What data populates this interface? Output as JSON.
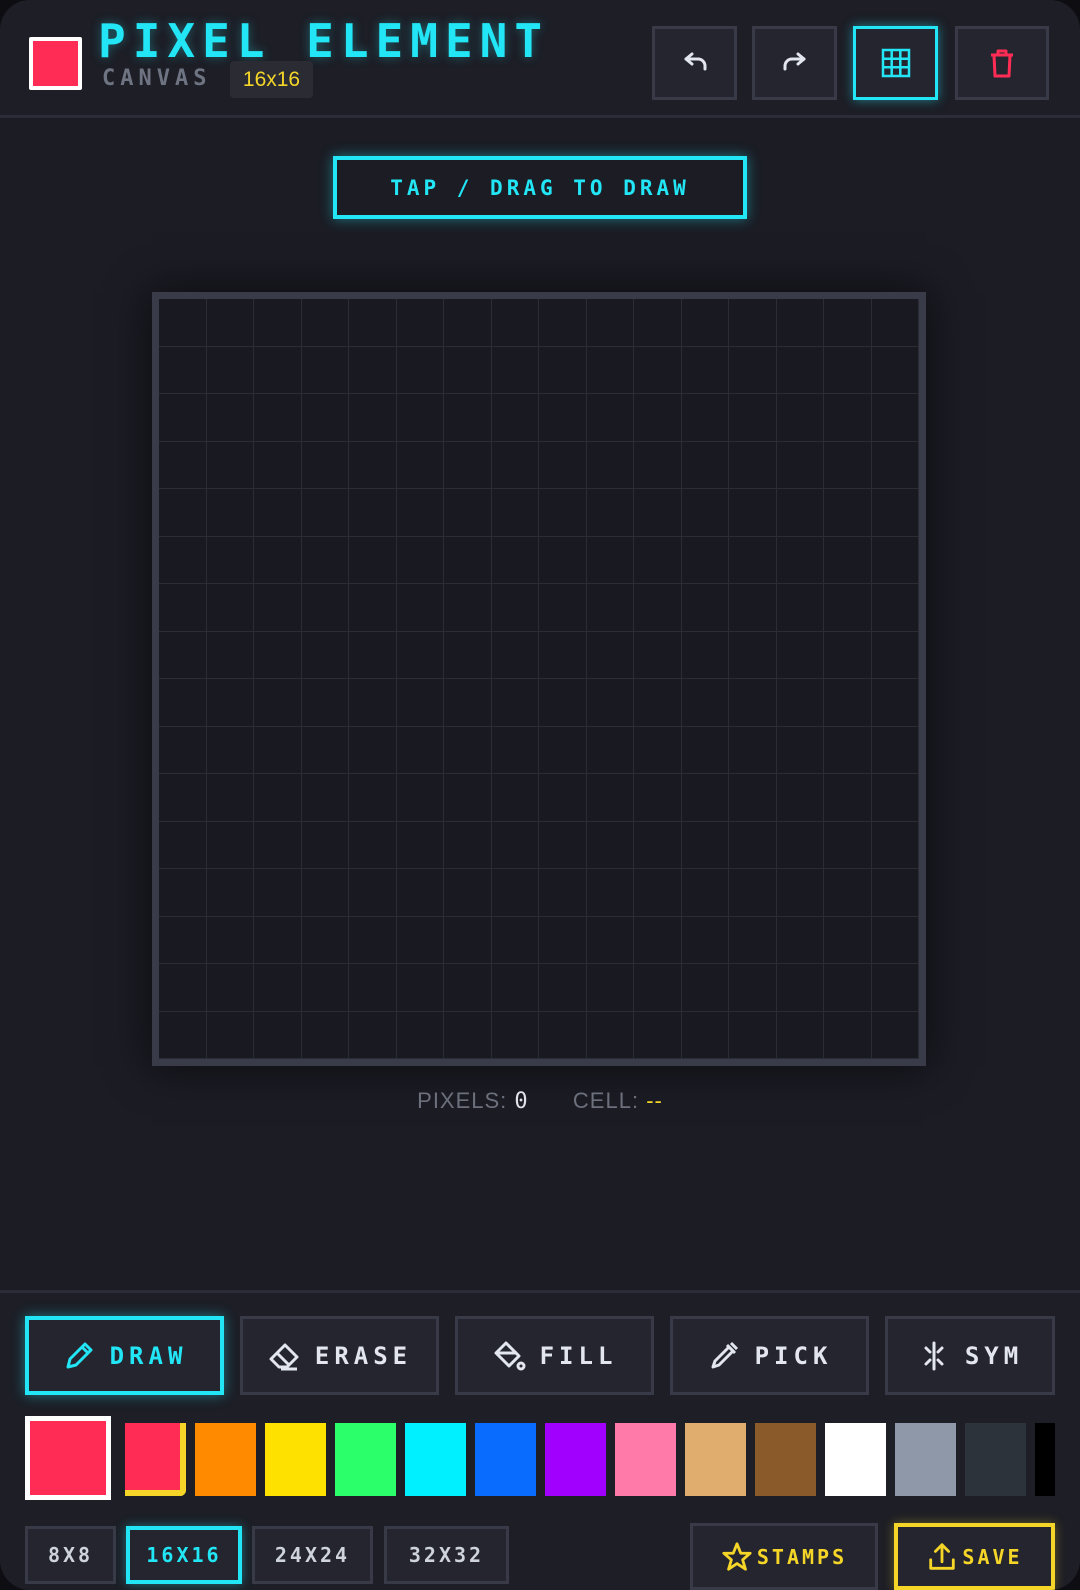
{
  "header": {
    "title": "PIXEL ELEMENT",
    "subtitle": "CANVAS",
    "size_badge": "16x16",
    "current_color": "#ff2d55",
    "buttons": [
      {
        "name": "undo-button",
        "icon": "undo-icon"
      },
      {
        "name": "redo-button",
        "icon": "redo-icon"
      },
      {
        "name": "grid-toggle-button",
        "icon": "grid-icon",
        "active": true
      },
      {
        "name": "clear-button",
        "icon": "trash-icon"
      }
    ]
  },
  "hint": "TAP / DRAG TO DRAW",
  "canvas": {
    "columns": 16,
    "rows": 16,
    "filled_pixels": 0
  },
  "stats": {
    "pixels_label": "PIXELS:",
    "pixels_value": "0",
    "cell_label": "CELL:",
    "cell_value": "--"
  },
  "tools": [
    {
      "label": "DRAW",
      "icon": "pencil-icon",
      "active": true
    },
    {
      "label": "ERASE",
      "icon": "eraser-icon",
      "active": false
    },
    {
      "label": "FILL",
      "icon": "paint-bucket-icon",
      "active": false
    },
    {
      "label": "PICK",
      "icon": "eyedropper-icon",
      "active": false
    },
    {
      "label": "SYM",
      "icon": "symmetry-icon",
      "active": false
    }
  ],
  "palette": {
    "selected": "#ff2d55",
    "colors": [
      "#ff2d55",
      "#ff2d55",
      "#ff8a00",
      "#ffe100",
      "#2bff6a",
      "#00f0ff",
      "#0a6cff",
      "#a100ff",
      "#ff7aa8",
      "#e0ad6e",
      "#8b5a2b",
      "#ffffff",
      "#8e98a8",
      "#2d333a",
      "#000000"
    ]
  },
  "sizes": {
    "options": [
      "8X8",
      "16X16",
      "24X24",
      "32X32"
    ],
    "selected": "16X16"
  },
  "actions": {
    "stamps_label": "STAMPS",
    "save_label": "SAVE",
    "accent": "#f5d628"
  },
  "colors": {
    "accent": "#22e6f5",
    "danger": "#ff2d55",
    "highlight": "#f5d628"
  }
}
